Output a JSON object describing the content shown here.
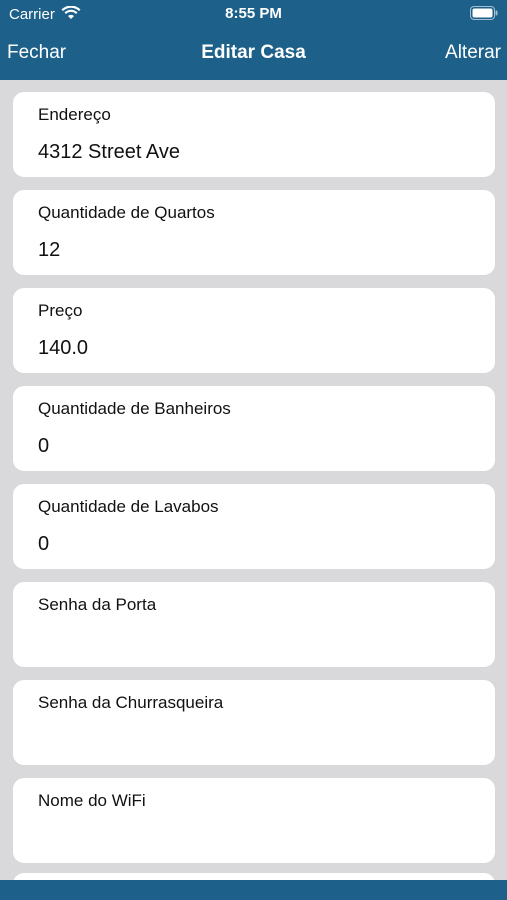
{
  "status": {
    "carrier": "Carrier",
    "time": "8:55 PM"
  },
  "nav": {
    "left": "Fechar",
    "title": "Editar Casa",
    "right": "Alterar"
  },
  "fields": [
    {
      "label": "Endereço",
      "value": "4312 Street Ave"
    },
    {
      "label": "Quantidade de Quartos",
      "value": "12"
    },
    {
      "label": "Preço",
      "value": "140.0"
    },
    {
      "label": "Quantidade de Banheiros",
      "value": "0"
    },
    {
      "label": "Quantidade de Lavabos",
      "value": "0"
    },
    {
      "label": "Senha da Porta",
      "value": ""
    },
    {
      "label": "Senha da Churrasqueira",
      "value": ""
    },
    {
      "label": "Nome do WiFi",
      "value": ""
    }
  ],
  "colors": {
    "navbar": "#1d6089",
    "background": "#d9d9dc",
    "card": "#ffffff"
  },
  "icons": {
    "wifi": "wifi-icon",
    "battery": "battery-icon"
  }
}
